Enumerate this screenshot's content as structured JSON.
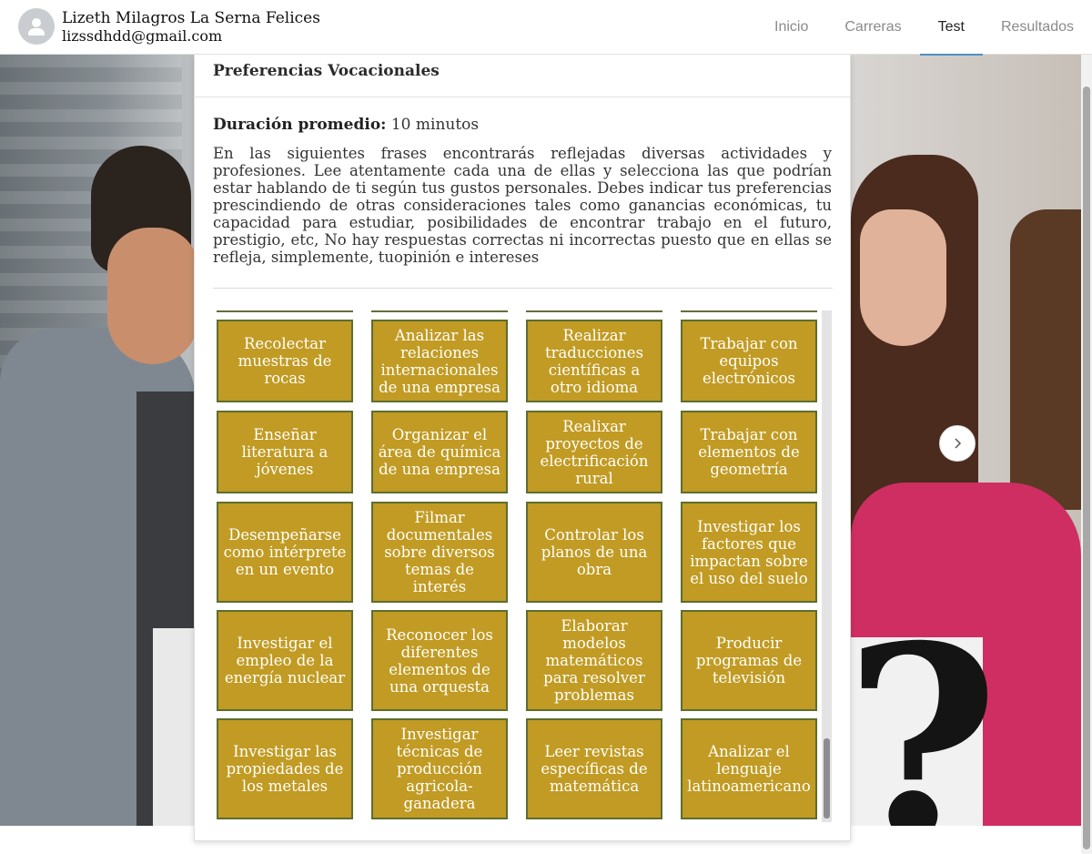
{
  "header": {
    "user_name": "Lizeth Milagros La Serna Felices",
    "user_email": "lizssdhdd@gmail.com",
    "avatar_icon": "user-icon"
  },
  "nav": {
    "items": [
      "Inicio",
      "Carreras",
      "Test",
      "Resultados"
    ],
    "active": "Test",
    "active_color": "#4a90c8"
  },
  "card": {
    "title": "Preferencias Vocacionales",
    "duration_label": "Duración promedio:",
    "duration_value": "10 minutos",
    "description": "En las siguientes frases encontrarás reflejadas diversas actividades y profesiones. Lee atentamente cada una de ellas y selecciona las que podrían estar hablando de ti según tus gustos personales. Debes indicar tus preferencias prescindiendo de otras consideraciones tales como ganancias económicas, tu capacidad para estudiar, posibilidades de encontrar trabajo en el futuro, prestigio, etc, No hay respuestas correctas ni incorrectas puesto que en ellas se refleja, simplemente, tuopinión e intereses"
  },
  "activities": [
    [
      "Recolectar muestras de rocas",
      "Analizar las relaciones internacionales de una empresa",
      "Realizar traducciones científicas a otro idioma",
      "Trabajar con equipos electrónicos"
    ],
    [
      "Enseñar literatura a jóvenes",
      "Organizar el área de química de una empresa",
      "Realixar proyectos de electrificación rural",
      "Trabajar con elementos de geometría"
    ],
    [
      "Desempeñarse como intérprete en un evento",
      "Filmar documentales sobre diversos temas de interés",
      "Controlar los planos de una obra",
      "Investigar los factores que impactan sobre el uso del suelo"
    ],
    [
      "Investigar el empleo de la energía nuclear",
      "Reconocer los diferentes elementos de una orquesta",
      "Elaborar modelos matemáticos para resolver problemas",
      "Producir programas de televisión"
    ],
    [
      "Investigar las propiedades de los metales",
      "Investigar técnicas de producción agricola-ganadera",
      "Leer revistas específicas de matemática",
      "Analizar el lenguaje latinoamericano"
    ]
  ],
  "colors": {
    "tile_background": "#c19b23",
    "tile_border": "#5b6e2f",
    "tile_text": "#ffffff"
  },
  "carousel": {
    "next_icon": "chevron-right-icon"
  }
}
